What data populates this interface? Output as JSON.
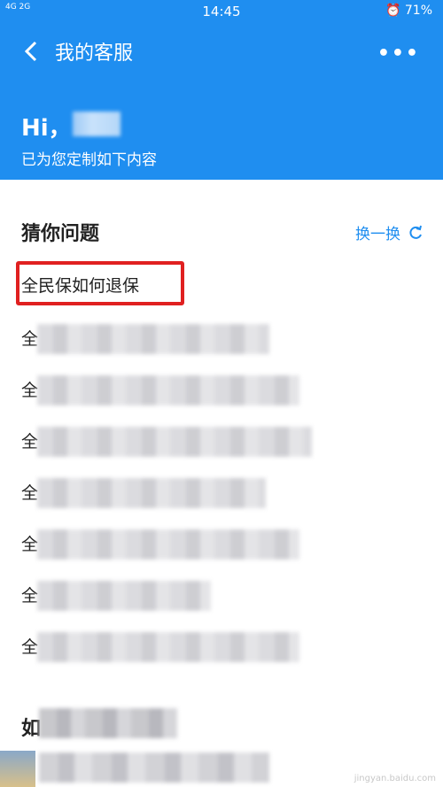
{
  "status_bar": {
    "signal": "4G 2G",
    "time": "14:45",
    "battery": "71%",
    "alarm_icon": "alarm-icon"
  },
  "header": {
    "title": "我的客服",
    "greeting": "Hi，",
    "subtitle": "已为您定制如下内容"
  },
  "guess": {
    "title": "猜你问题",
    "refresh_label": "换一换",
    "first_question": "全民保如何退保",
    "blurred_prefix": "全",
    "blurred_rows": 7
  },
  "section2": {
    "title_prefix": "如"
  },
  "watermark": "jingyan.baidu.com",
  "colors": {
    "primary": "#1f8ef0",
    "highlight": "#e02020"
  }
}
